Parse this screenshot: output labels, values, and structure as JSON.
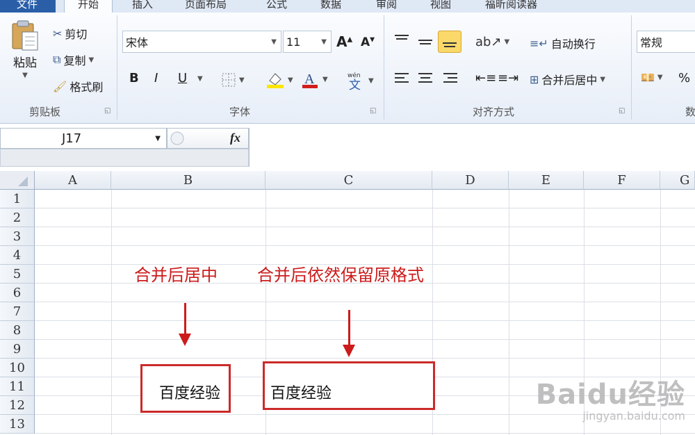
{
  "tabs": [
    "文件",
    "开始",
    "插入",
    "页面布局",
    "公式",
    "数据",
    "审阅",
    "视图",
    "福昕阅读器"
  ],
  "clipboard": {
    "paste": "粘贴",
    "cut": "剪切",
    "copy": "复制",
    "format_painter": "格式刷",
    "label": "剪贴板"
  },
  "font": {
    "name": "宋体",
    "size": "11",
    "bold": "B",
    "italic": "I",
    "underline": "U",
    "wen": "wén",
    "label": "字体"
  },
  "alignment": {
    "wrap_text": "自动换行",
    "merge_center": "合并后居中",
    "label": "对齐方式"
  },
  "number": {
    "format": "常规",
    "percent": "%",
    "label": "数"
  },
  "formula_bar": {
    "name_box": "J17",
    "fx": "fx"
  },
  "grid": {
    "columns": [
      "A",
      "B",
      "C",
      "D",
      "E",
      "F",
      "G"
    ],
    "rows": [
      "1",
      "2",
      "3",
      "4",
      "5",
      "6",
      "7",
      "8",
      "9",
      "10",
      "11",
      "12",
      "13"
    ]
  },
  "annotations": {
    "left": "合并后居中",
    "right": "合并后依然保留原格式"
  },
  "cells": {
    "left_merged": "百度经验",
    "right_merged": "百度经验"
  },
  "watermark": {
    "brand": "Baidu经验",
    "url": "jingyan.baidu.com"
  },
  "colors": {
    "accent_red": "#cc1b1b",
    "file_tab": "#2a5fa8"
  }
}
